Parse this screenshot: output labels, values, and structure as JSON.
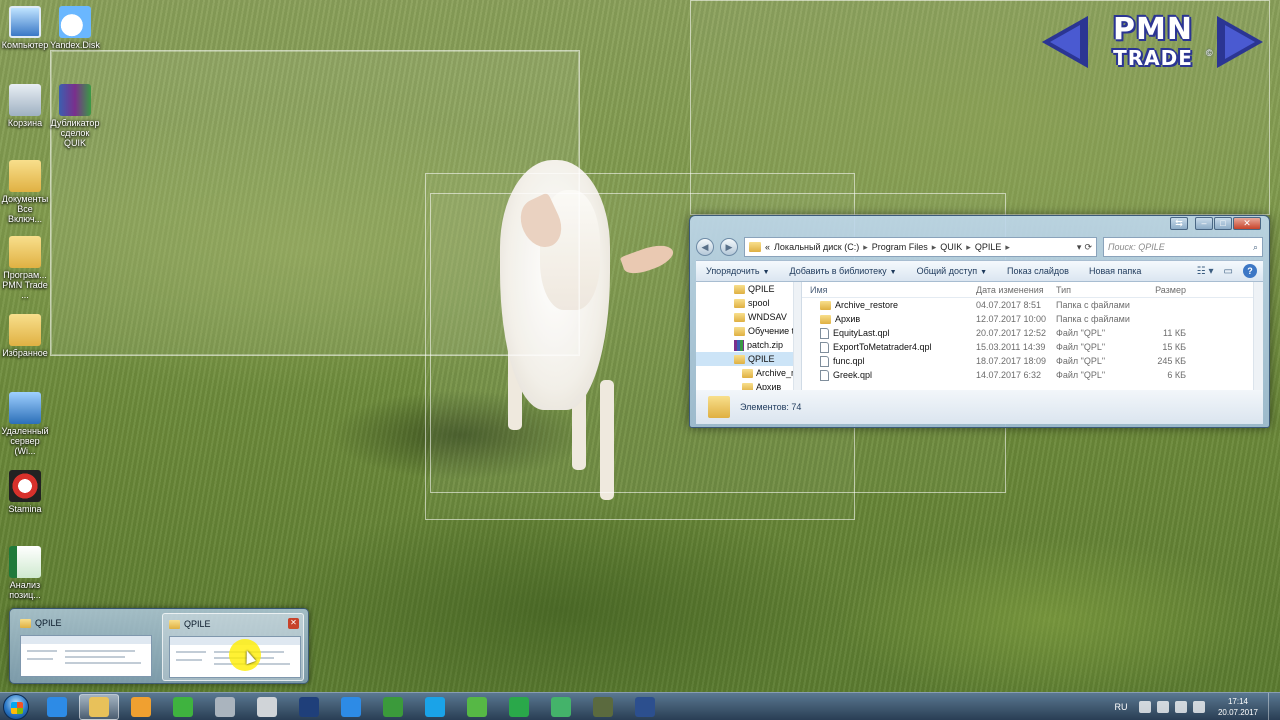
{
  "desktop": {
    "icons": [
      {
        "label": "Компьютер",
        "icon": "computer-icon"
      },
      {
        "label": "Yandex.Disk",
        "icon": "yandex-disk-icon"
      },
      {
        "label": "Корзина",
        "icon": "recycle-bin-icon"
      },
      {
        "label": "Дубликатор сделок QUIK",
        "icon": "winrar-icon"
      },
      {
        "label": "Документы Все Включ...",
        "icon": "folder-icon"
      },
      {
        "label": "Програм... PMN Trade ...",
        "icon": "folder-icon"
      },
      {
        "label": "Избранное",
        "icon": "folder-icon"
      },
      {
        "label": "Удаленный сервер (Wi...",
        "icon": "remote-desktop-icon"
      },
      {
        "label": "Stamina",
        "icon": "stamina-icon"
      },
      {
        "label": "Анализ позиц...",
        "icon": "excel-icon"
      }
    ]
  },
  "logo": {
    "line1": "PMN",
    "line2": "TRADE",
    "mark": "©"
  },
  "explorer": {
    "breadcrumb": [
      "«",
      "Локальный диск (C:)",
      "Program Files",
      "QUIK",
      "QPILE"
    ],
    "search_placeholder": "Поиск: QPILE",
    "commands": [
      "Упорядочить",
      "Добавить в библиотеку",
      "Общий доступ",
      "Показ слайдов",
      "Новая папка"
    ],
    "nav_tree": [
      {
        "label": "QPILE",
        "type": "folder",
        "child": false,
        "selected": false
      },
      {
        "label": "spool",
        "type": "folder",
        "child": false,
        "selected": false
      },
      {
        "label": "WNDSAV",
        "type": "folder",
        "child": false,
        "selected": false
      },
      {
        "label": "Обучение t",
        "type": "folder",
        "child": false,
        "selected": false
      },
      {
        "label": "patch.zip",
        "type": "zip",
        "child": false,
        "selected": false
      },
      {
        "label": "QPILE",
        "type": "folder",
        "child": false,
        "selected": true
      },
      {
        "label": "Archive_r",
        "type": "folder",
        "child": true,
        "selected": false
      },
      {
        "label": "Архив",
        "type": "folder",
        "child": true,
        "selected": false
      }
    ],
    "columns": {
      "name": "Имя",
      "date": "Дата изменения",
      "type": "Тип",
      "size": "Размер"
    },
    "files": [
      {
        "name": "Archive_restore",
        "kind": "folder",
        "date": "04.07.2017 8:51",
        "type": "Папка с файлами",
        "size": ""
      },
      {
        "name": "Архив",
        "kind": "folder",
        "date": "12.07.2017 10:00",
        "type": "Папка с файлами",
        "size": ""
      },
      {
        "name": "EquityLast.qpl",
        "kind": "file",
        "date": "20.07.2017 12:52",
        "type": "Файл \"QPL\"",
        "size": "11 КБ"
      },
      {
        "name": "ExportToMetatrader4.qpl",
        "kind": "file",
        "date": "15.03.2011 14:39",
        "type": "Файл \"QPL\"",
        "size": "15 КБ"
      },
      {
        "name": "func.qpl",
        "kind": "file",
        "date": "18.07.2017 18:09",
        "type": "Файл \"QPL\"",
        "size": "245 КБ"
      },
      {
        "name": "Greek.qpl",
        "kind": "file",
        "date": "14.07.2017 6:32",
        "type": "Файл \"QPL\"",
        "size": "6 КБ"
      }
    ],
    "status": "Элементов: 74"
  },
  "thumbnails": [
    {
      "title": "QPILE",
      "hover": false
    },
    {
      "title": "QPILE",
      "hover": true
    }
  ],
  "taskbar": {
    "apps": [
      {
        "name": "internet-explorer",
        "color": "#2d8be6",
        "active": false
      },
      {
        "name": "windows-explorer",
        "color": "#e8c15a",
        "active": true
      },
      {
        "name": "media-app",
        "color": "#f0a030",
        "active": false
      },
      {
        "name": "upload-app",
        "color": "#3fb33f",
        "active": false
      },
      {
        "name": "tools-app",
        "color": "#aab4be",
        "active": false
      },
      {
        "name": "printer-app",
        "color": "#d0d4d8",
        "active": false
      },
      {
        "name": "photoshop",
        "color": "#1f3f7a",
        "active": false
      },
      {
        "name": "media-player",
        "color": "#2d8be6",
        "active": false
      },
      {
        "name": "chart-app",
        "color": "#3b9a3b",
        "active": false
      },
      {
        "name": "skype",
        "color": "#1aa3e8",
        "active": false
      },
      {
        "name": "utorrent",
        "color": "#56b845",
        "active": false
      },
      {
        "name": "quik-green",
        "color": "#2aa84a",
        "active": false
      },
      {
        "name": "quik-green-2",
        "color": "#44b36a",
        "active": false
      },
      {
        "name": "torch-app",
        "color": "#5b6a3e",
        "active": false
      },
      {
        "name": "quik-terminal",
        "color": "#2c4f8e",
        "active": false
      }
    ],
    "language": "RU",
    "time": "17:14",
    "date": "20.07.2017"
  }
}
